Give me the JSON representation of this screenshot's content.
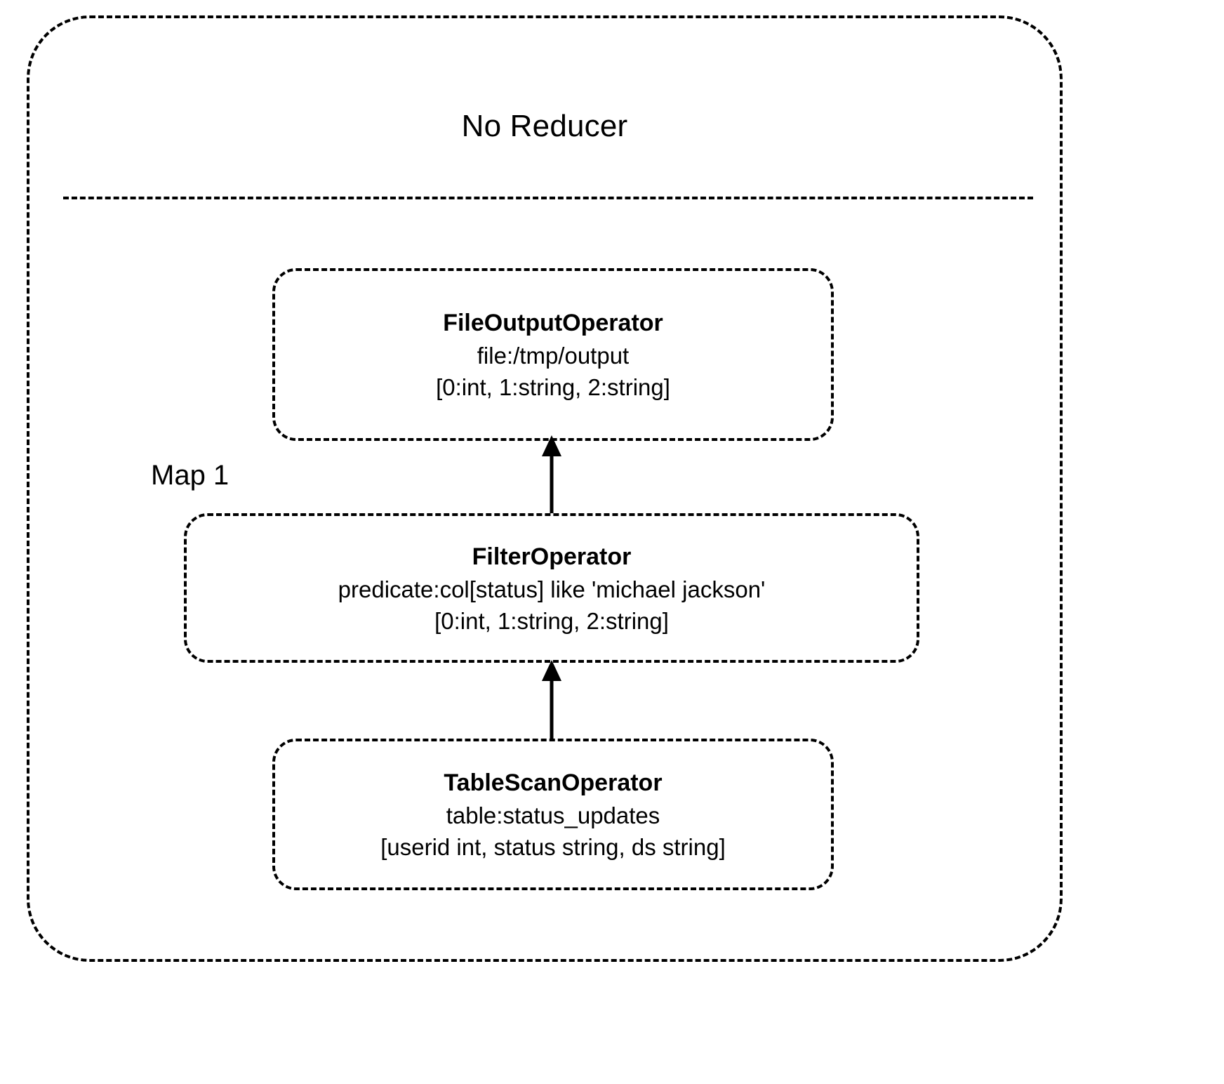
{
  "stage": {
    "title": "No Reducer",
    "vertex_label": "Map 1"
  },
  "operators": [
    {
      "id": "file-output-operator",
      "title": "FileOutputOperator",
      "detail": "file:/tmp/output",
      "schema": "[0:int, 1:string, 2:string]"
    },
    {
      "id": "filter-operator",
      "title": "FilterOperator",
      "detail": "predicate:col[status] like 'michael jackson'",
      "schema": "[0:int, 1:string, 2:string]"
    },
    {
      "id": "table-scan-operator",
      "title": "TableScanOperator",
      "detail": "table:status_updates",
      "schema": "[userid int, status string, ds string]"
    }
  ],
  "edges": [
    {
      "id": "scan-to-filter",
      "from": "table-scan-operator",
      "to": "filter-operator"
    },
    {
      "id": "filter-to-fileoutput",
      "from": "filter-operator",
      "to": "file-output-operator"
    }
  ],
  "colors": {
    "stroke": "#000000",
    "background": "#ffffff",
    "text": "#000000"
  }
}
